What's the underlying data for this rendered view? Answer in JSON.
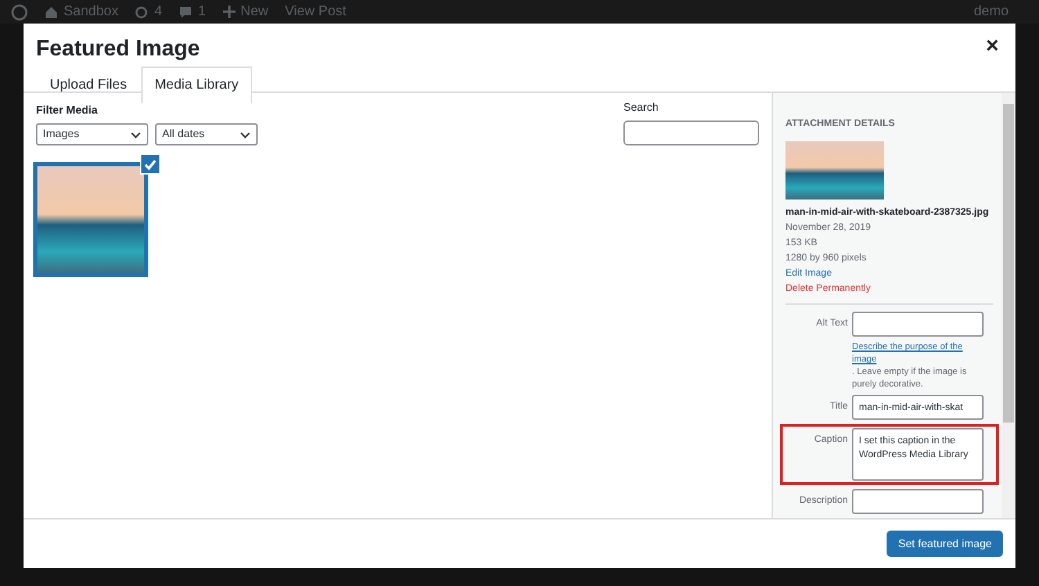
{
  "admin_bar": {
    "site": "Sandbox",
    "updates": "4",
    "comments": "1",
    "new": "New",
    "view_post": "View Post",
    "user": "demo"
  },
  "modal": {
    "title": "Featured Image",
    "close": "×",
    "tabs": [
      {
        "label": "Upload Files",
        "selected": false
      },
      {
        "label": "Media Library",
        "selected": true
      }
    ],
    "filter": {
      "label": "Filter Media",
      "type_value": "Images",
      "date_value": "All dates"
    },
    "search": {
      "label": "Search"
    },
    "attachments": [
      {
        "selected": true
      }
    ],
    "details": {
      "heading": "ATTACHMENT DETAILS",
      "filename": "man-in-mid-air-with-skateboard-2387325.jpg",
      "date": "November 28, 2019",
      "size": "153 KB",
      "dimensions": "1280 by 960 pixels",
      "edit_link": "Edit Image",
      "delete_link": "Delete Permanently",
      "fields": [
        {
          "label": "Alt Text",
          "help_link": "Describe the purpose of the image",
          "help_text": ". Leave empty if the image is purely decorative.",
          "highlighted": false
        },
        {
          "label": "Title",
          "value": "man-in-mid-air-with-skat",
          "highlighted": false
        },
        {
          "label": "Caption",
          "value": "I set this caption in the WordPress Media Library",
          "highlighted": true
        },
        {
          "label": "Description",
          "highlighted": false
        }
      ]
    },
    "button": "Set featured image"
  }
}
